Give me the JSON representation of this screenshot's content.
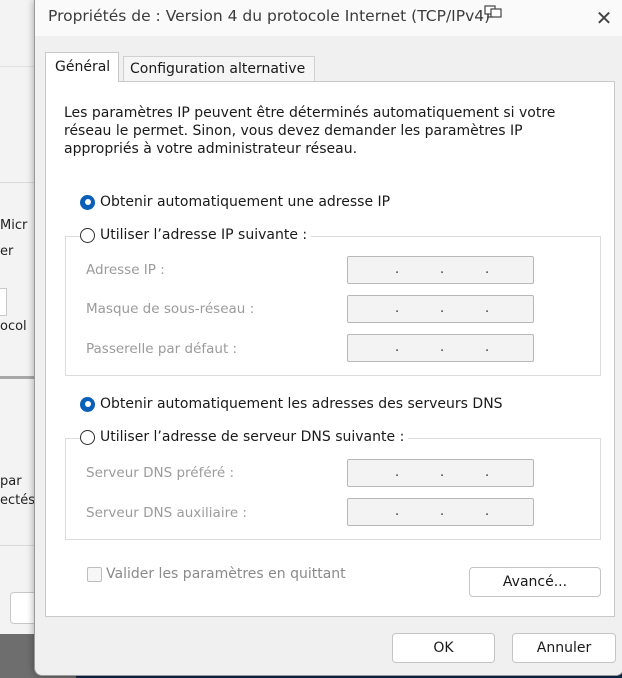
{
  "background_window": {
    "fragments": [
      "Micr",
      "er",
      "ocol",
      "par",
      "ectés"
    ]
  },
  "dialog": {
    "title": "Propriétés de : Version 4 du protocole Internet (TCP/IPv4)",
    "close_label": "✕",
    "tabs": [
      {
        "label": "Général",
        "selected": true
      },
      {
        "label": "Configuration alternative",
        "selected": false
      }
    ],
    "description": "Les paramètres IP peuvent être déterminés automatiquement si votre réseau le permet. Sinon, vous devez demander les paramètres IP appropriés à votre administrateur réseau.",
    "ip": {
      "auto_label": "Obtenir automatiquement une adresse IP",
      "auto_selected": true,
      "manual_label": "Utiliser l’adresse IP suivante :",
      "fields": [
        {
          "label": "Adresse IP :",
          "value": ""
        },
        {
          "label": "Masque de sous-réseau :",
          "value": ""
        },
        {
          "label": "Passerelle par défaut :",
          "value": ""
        }
      ]
    },
    "dns": {
      "auto_label": "Obtenir automatiquement les adresses des serveurs DNS",
      "auto_selected": true,
      "manual_label": "Utiliser l’adresse de serveur DNS suivante :",
      "fields": [
        {
          "label": "Serveur DNS préféré :",
          "value": ""
        },
        {
          "label": "Serveur DNS auxiliaire :",
          "value": ""
        }
      ]
    },
    "validate_label": "Valider les paramètres en quittant",
    "validate_checked": false,
    "advanced_button": "Avancé...",
    "ok_button": "OK",
    "cancel_button": "Annuler",
    "accent_color": "#0a5fb8"
  }
}
